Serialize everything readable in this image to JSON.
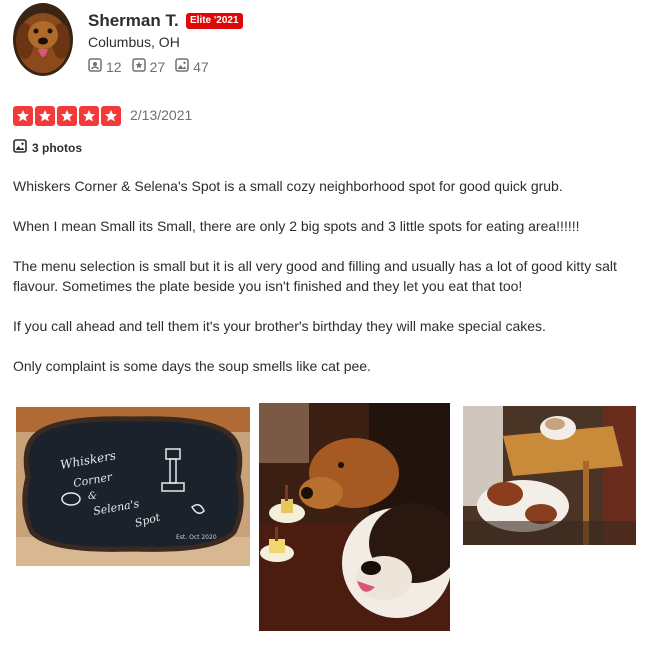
{
  "user": {
    "name": "Sherman T.",
    "elite_badge": "Elite '2021",
    "location": "Columbus, OH",
    "stats": [
      {
        "icon": "friends-icon",
        "value": "12"
      },
      {
        "icon": "review-star-icon",
        "value": "27"
      },
      {
        "icon": "photo-icon",
        "value": "47"
      }
    ]
  },
  "review": {
    "rating": 5,
    "date": "2/13/2021",
    "photos_label": "3 photos",
    "paragraphs": [
      "Whiskers Corner & Selena's Spot is a small cozy neighborhood spot for good quick grub.",
      "When I mean Small its Small, there are only 2 big spots and 3 little spots for eating area!!!!!!",
      "The menu selection is small but it is all very good and filling and usually has a lot of good kitty salt flavour. Sometimes the plate beside you isn't finished and they let you eat that too!",
      "If you call ahead and tell them it's your brother's birthday they will make special cakes.",
      "Only complaint is some days the soup smells like cat pee."
    ]
  },
  "photos": [
    {
      "alt": "chalkboard sign",
      "sign_text": "Whiskers Corner & Selena's Spot"
    },
    {
      "alt": "dogs at table with cakes"
    },
    {
      "alt": "cat on table and dog"
    }
  ],
  "colors": {
    "accent": "#e00707",
    "star": "#f43939",
    "text": "#2d2e2f",
    "muted": "#6e7072"
  }
}
